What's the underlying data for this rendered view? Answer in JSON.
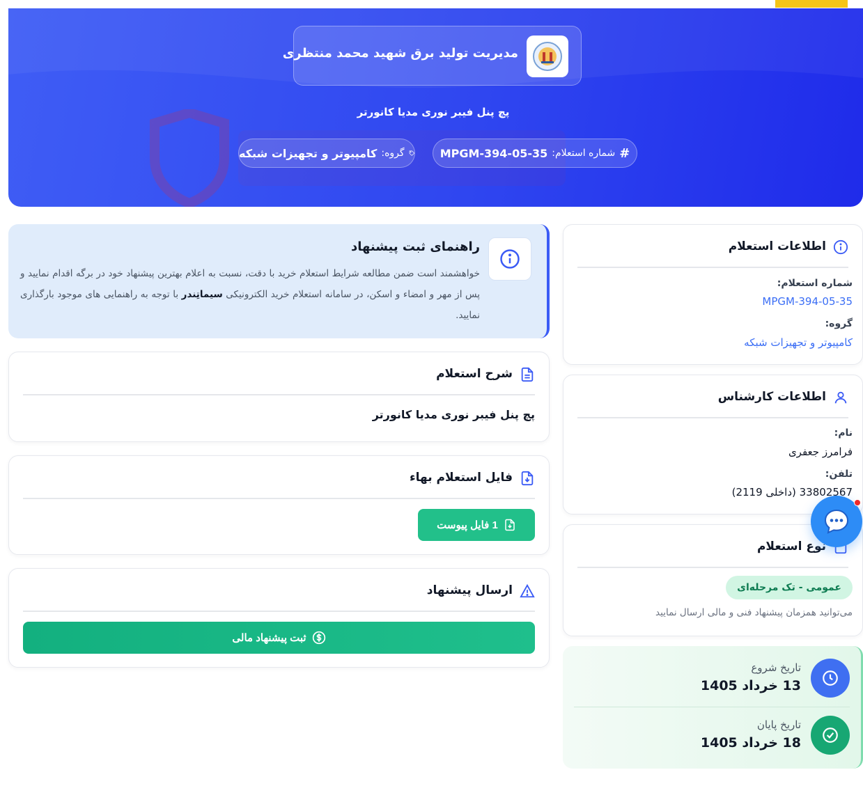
{
  "header": {
    "organization": "مدیریت تولید برق شهید محمد منتظری",
    "subtitle": "پچ پنل فیبر نوری مدیا کانورتر",
    "number_label": "شماره استعلام:",
    "number_value": "MPGM-394-05-35",
    "group_label": "گروه:",
    "group_value": "کامپیوتر و تجهیزات شبکه"
  },
  "guide": {
    "title": "راهنمای ثبت پیشنهاد",
    "text_part1": "خواهشمند است ضمن مطالعه شرایط استعلام خرید با دقت، نسبت به اعلام بهترین پیشنهاد خود در برگه اقدام نمایید و پس از مهر و امضاء و اسکن، در سامانه استعلام خرید الکترونیکی ",
    "brand": "سیماتِندر",
    "text_part2": " با توجه به راهنمایی های موجود بارگذاری نمایید."
  },
  "description": {
    "title": "شرح استعلام",
    "body": "پچ پنل فیبر نوری مدیا کانورتر"
  },
  "file": {
    "title": "فایل استعلام بهاء",
    "button": "1 فایل پیوست"
  },
  "send": {
    "title": "ارسال پیشنهاد",
    "button": "ثبت پیشنهاد مالی"
  },
  "inquiry_info": {
    "title": "اطلاعات استعلام",
    "number_label": "شماره استعلام:",
    "number_value": "MPGM-394-05-35",
    "group_label": "گروه:",
    "group_value": "کامپیوتر و تجهیزات شبکه"
  },
  "expert": {
    "title": "اطلاعات کارشناس",
    "name_label": "نام:",
    "name_value": "فرامرز جعفری",
    "phone_label": "تلفن:",
    "phone_value": "33802567 (داخلی 2119)"
  },
  "type": {
    "title": "نوع استعلام",
    "badge": "عمومی - تک مرحله‌ای",
    "note": "می‌توانید همزمان پیشنهاد فنی و مالی ارسال نمایید"
  },
  "dates": {
    "start_label": "تاریخ شروع",
    "start_value": "13 خرداد 1405",
    "end_label": "تاریخ پایان",
    "end_value": "18 خرداد 1405"
  },
  "colors": {
    "hero_blue": "#2f46f0",
    "accent_green": "#22c08a",
    "link_blue": "#3b6ef5"
  },
  "icons": [
    "info-icon",
    "hash-icon",
    "tag-icon",
    "document-icon",
    "file-download-icon",
    "warning-icon",
    "user-icon",
    "dollar-icon",
    "clock-icon",
    "check-circle-icon",
    "chat-icon"
  ]
}
